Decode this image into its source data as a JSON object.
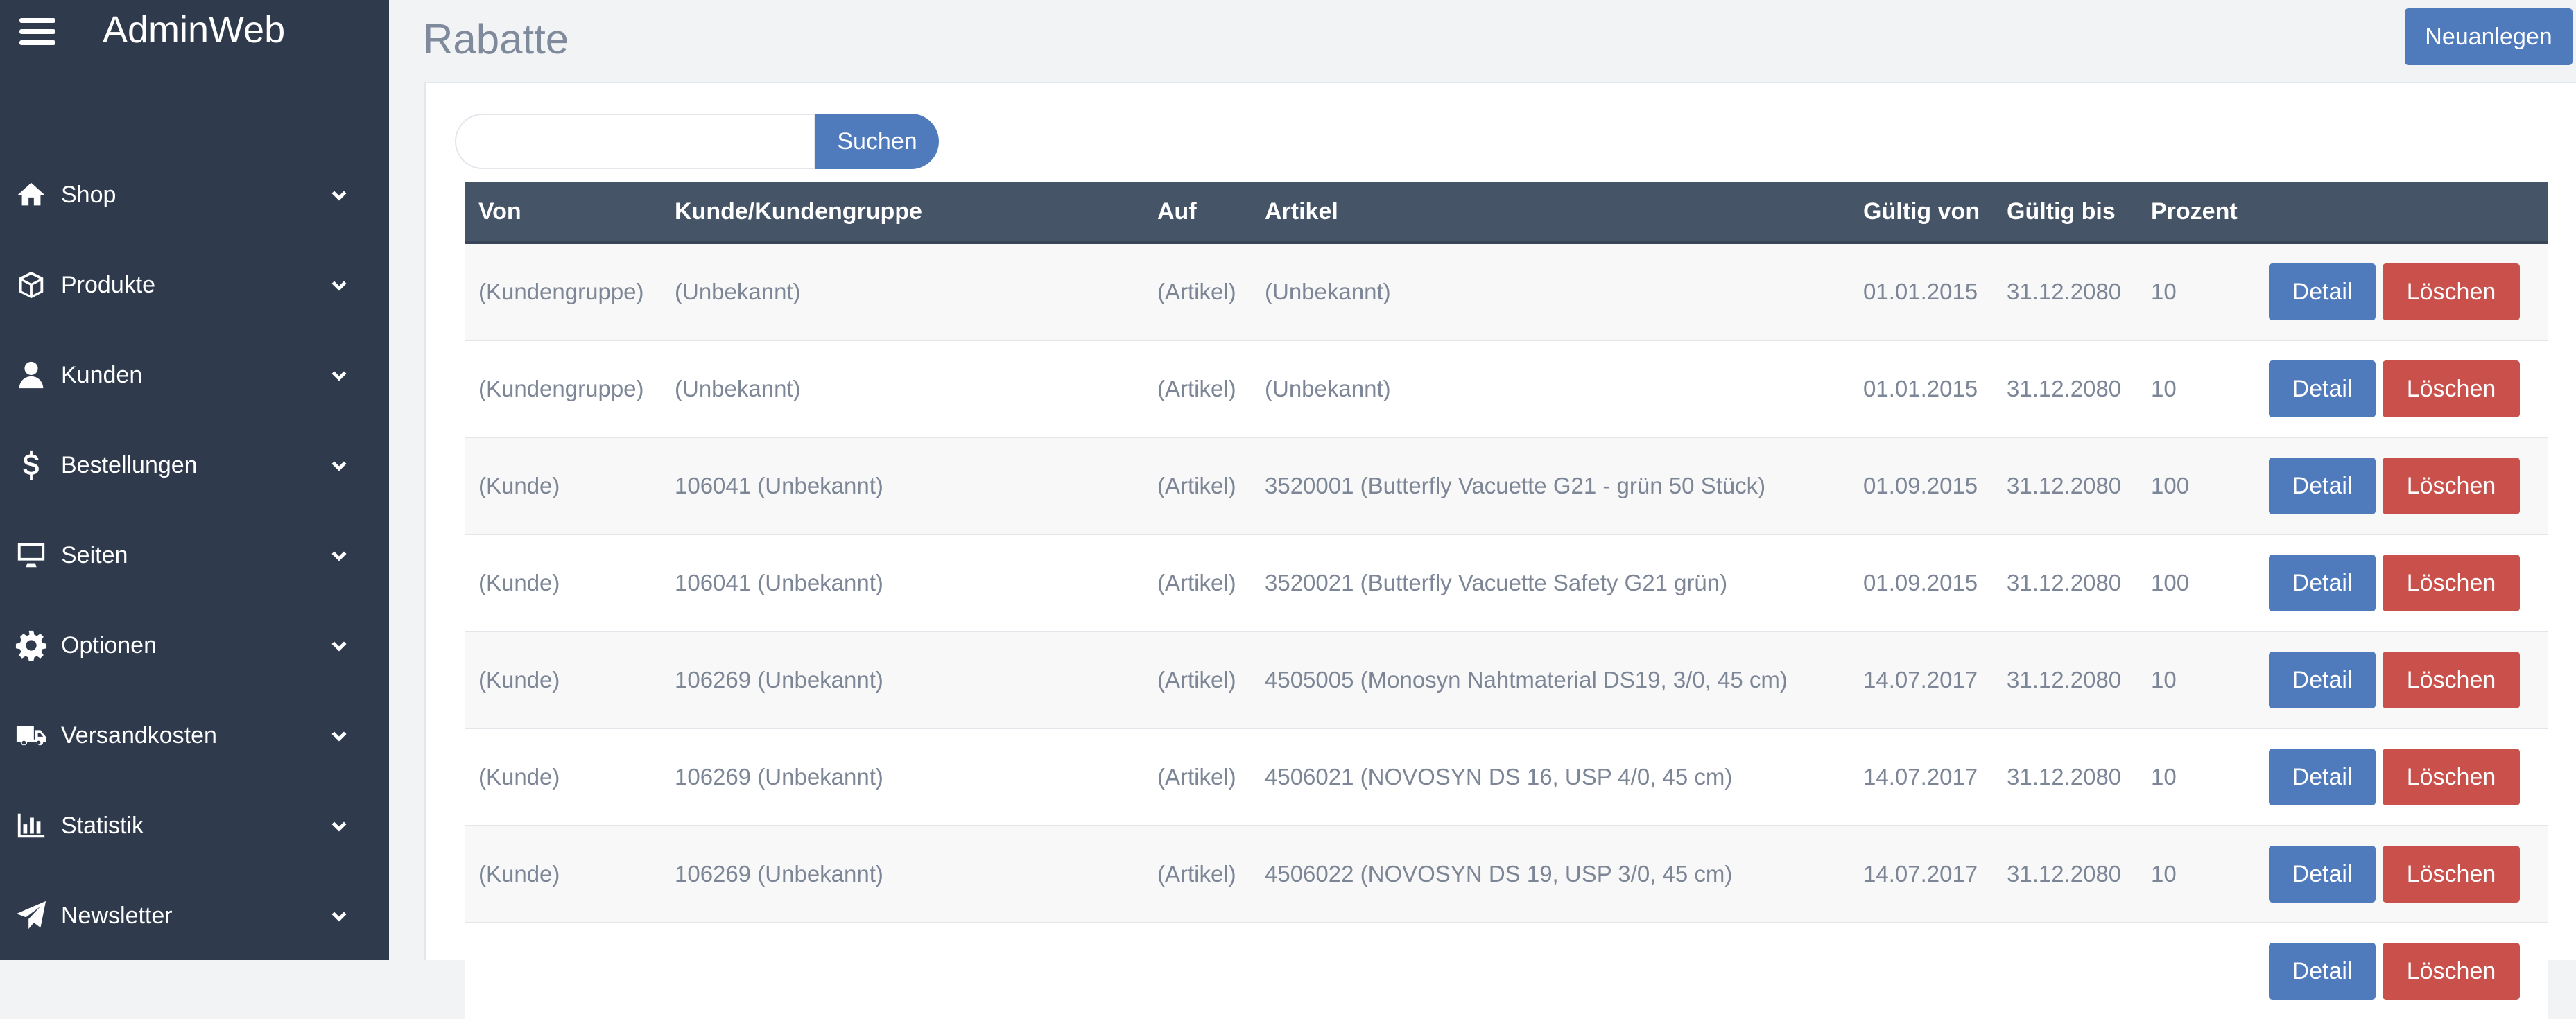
{
  "app": {
    "title": "AdminWeb"
  },
  "sidebar": {
    "items": [
      {
        "label": "Shop",
        "icon": "home-icon"
      },
      {
        "label": "Produkte",
        "icon": "box-icon"
      },
      {
        "label": "Kunden",
        "icon": "user-icon"
      },
      {
        "label": "Bestellungen",
        "icon": "dollar-icon"
      },
      {
        "label": "Seiten",
        "icon": "monitor-icon"
      },
      {
        "label": "Optionen",
        "icon": "gear-icon"
      },
      {
        "label": "Versandkosten",
        "icon": "truck-icon"
      },
      {
        "label": "Statistik",
        "icon": "bar-chart-icon"
      },
      {
        "label": "Newsletter",
        "icon": "paper-plane-icon"
      }
    ]
  },
  "header": {
    "title": "Rabatte",
    "new_label": "Neuanlegen"
  },
  "search": {
    "value": "",
    "placeholder": "",
    "button_label": "Suchen"
  },
  "table": {
    "columns": [
      "Von",
      "Kunde/Kundengruppe",
      "Auf",
      "Artikel",
      "Gültig von",
      "Gültig bis",
      "Prozent",
      ""
    ],
    "detail_label": "Detail",
    "delete_label": "Löschen",
    "rows": [
      [
        "(Kundengruppe)",
        "(Unbekannt)",
        "(Artikel)",
        "(Unbekannt)",
        "01.01.2015",
        "31.12.2080",
        "10"
      ],
      [
        "(Kundengruppe)",
        "(Unbekannt)",
        "(Artikel)",
        "(Unbekannt)",
        "01.01.2015",
        "31.12.2080",
        "10"
      ],
      [
        "(Kunde)",
        "106041 (Unbekannt)",
        "(Artikel)",
        "3520001 (Butterfly Vacuette G21 - grün 50 Stück)",
        "01.09.2015",
        "31.12.2080",
        "100"
      ],
      [
        "(Kunde)",
        "106041 (Unbekannt)",
        "(Artikel)",
        "3520021 (Butterfly Vacuette Safety G21 grün)",
        "01.09.2015",
        "31.12.2080",
        "100"
      ],
      [
        "(Kunde)",
        "106269 (Unbekannt)",
        "(Artikel)",
        "4505005 (Monosyn Nahtmaterial DS19, 3/0, 45 cm)",
        "14.07.2017",
        "31.12.2080",
        "10"
      ],
      [
        "(Kunde)",
        "106269 (Unbekannt)",
        "(Artikel)",
        "4506021 (NOVOSYN DS 16, USP 4/0, 45 cm)",
        "14.07.2017",
        "31.12.2080",
        "10"
      ],
      [
        "(Kunde)",
        "106269 (Unbekannt)",
        "(Artikel)",
        "4506022 (NOVOSYN DS 19, USP 3/0, 45 cm)",
        "14.07.2017",
        "31.12.2080",
        "10"
      ],
      [
        "",
        "",
        "",
        "",
        "",
        "",
        ""
      ]
    ]
  },
  "colors": {
    "sidebar": "#2f3b4d",
    "header": "#465468",
    "primary": "#4f7bbd",
    "danger": "#c9504b"
  }
}
